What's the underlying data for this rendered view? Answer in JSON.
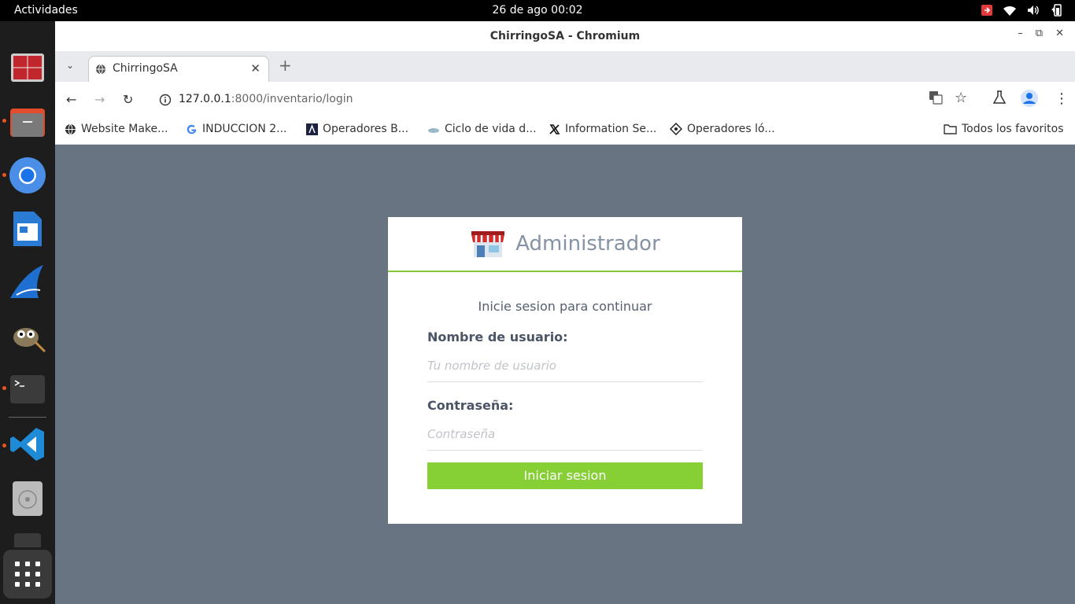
{
  "topbar": {
    "activities": "Actividades",
    "clock": "26 de ago  00:02"
  },
  "window": {
    "title": "ChirringoSA - Chromium"
  },
  "tab": {
    "title": "ChirringoSA"
  },
  "omnibox": {
    "host": "127.0.0.1",
    "path": ":8000/inventario/login"
  },
  "bookmarks": [
    {
      "label": "Website Make...",
      "icon": "globe-icon"
    },
    {
      "label": "INDUCCION 2...",
      "icon": "google-icon"
    },
    {
      "label": "Operadores B...",
      "icon": "site-icon"
    },
    {
      "label": "Ciclo de vida d...",
      "icon": "cloud-icon"
    },
    {
      "label": "Information Se...",
      "icon": "x-icon"
    },
    {
      "label": "Operadores ló...",
      "icon": "diamond-icon"
    }
  ],
  "bookmarks_all": "Todos los favoritos",
  "login": {
    "heading": "Administrador",
    "subtitle": "Inicie sesion para continuar",
    "user_label": "Nombre de usuario:",
    "user_placeholder": "Tu nombre de usuario",
    "pass_label": "Contraseña:",
    "pass_placeholder": "Contraseña",
    "submit": "Iniciar sesion"
  },
  "colors": {
    "accent": "#86cf35",
    "page_bg": "#687482",
    "heading": "#8593a5"
  }
}
